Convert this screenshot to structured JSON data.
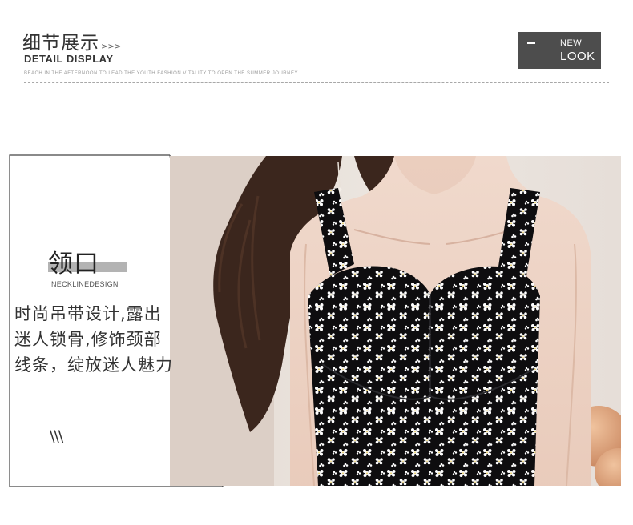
{
  "header": {
    "title": "细节展示",
    "arrows": ">>>",
    "subtitle": "DETAIL DISPLAY",
    "tagline": "BEACH IN THE AFTERNOON TO LEAD THE YOUTH FASHION  VITALITY TO OPEN THE SUMMER  JOURNEY"
  },
  "badge": {
    "line1": "NEW",
    "line2": "LOOK"
  },
  "detail": {
    "title": "领口",
    "subtitle": "NECKLINEDESIGN",
    "description": [
      "时尚吊带设计,露出",
      "迷人锁骨,修饰颈部",
      "线条，绽放迷人魅力"
    ],
    "slashes": "\\\\\\"
  },
  "colors": {
    "badge_bg": "#4d4d4d",
    "label_bar": "#b3b3b3",
    "dress": "#0e0d0f",
    "flower": "#ffffff"
  }
}
